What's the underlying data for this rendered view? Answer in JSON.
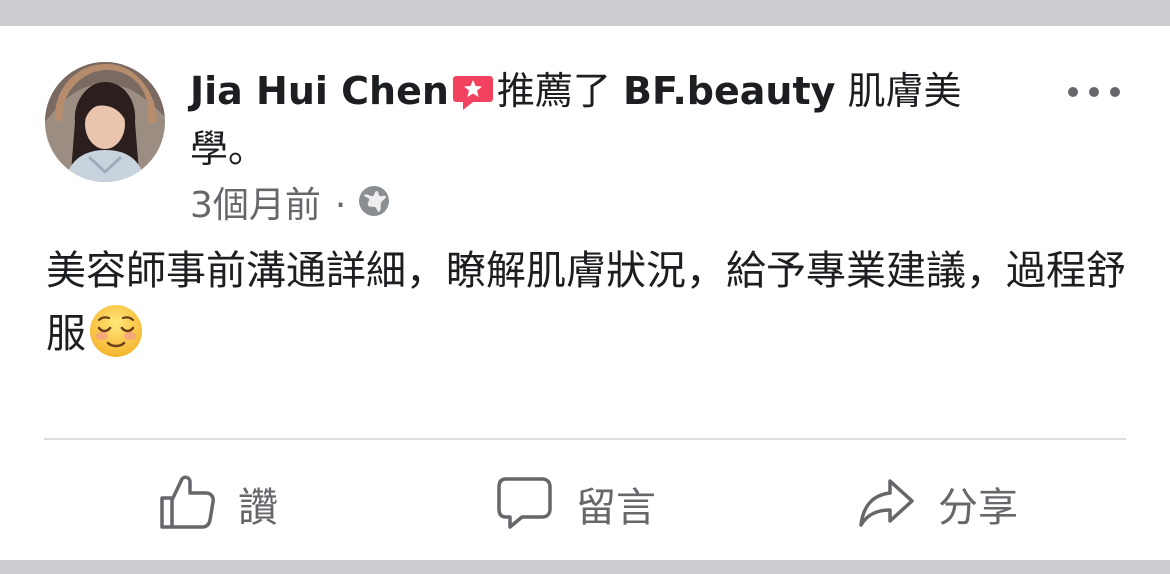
{
  "post": {
    "author": "Jia Hui Chen",
    "recommend_verb": "推薦了",
    "page_name": "BF.beauty",
    "page_suffix": " 肌膚美學。",
    "timestamp": "3個月前",
    "separator": "·",
    "privacy_icon": "globe-icon",
    "body": "美容師事前溝通詳細，瞭解肌膚狀況，給予專業建議，過程舒服",
    "emoji": "relieved-face-emoji"
  },
  "actions": {
    "like_label": "讚",
    "comment_label": "留言",
    "share_label": "分享"
  },
  "colors": {
    "recommend_badge": "#f3425f",
    "secondary_text": "#65676b",
    "primary_text": "#1c1e21",
    "divider": "#dadde1"
  }
}
